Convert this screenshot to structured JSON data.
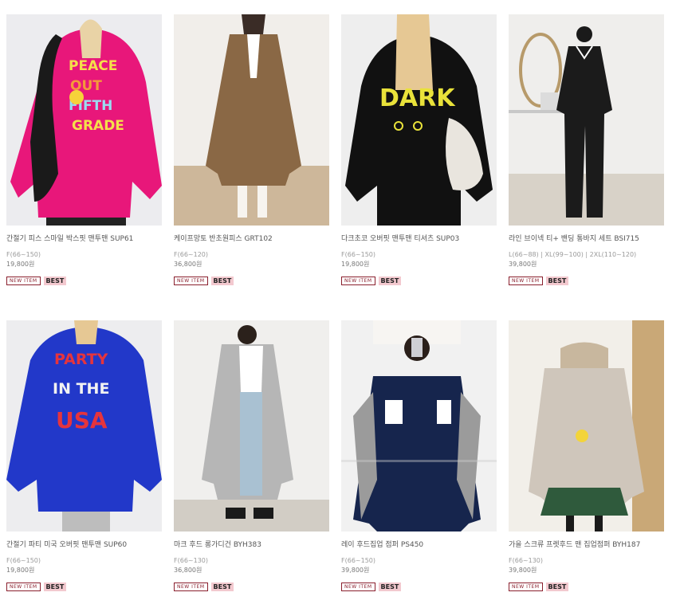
{
  "products": [
    {
      "name": "간절기 피스 스마일 박스핏 맨투맨 SUP61",
      "size": "F(66~150)",
      "price": "19,800원",
      "badge_new": "NEW ITEM",
      "badge_best": "BEST",
      "graphic_text": [
        "PEACE",
        "OUT",
        "FIFTH",
        "GRADE"
      ]
    },
    {
      "name": "케이프망토 반초원피스 GRT102",
      "size": "F(66~120)",
      "price": "36,800원",
      "badge_new": "NEW ITEM",
      "badge_best": "BEST"
    },
    {
      "name": "다크초코 오버핏 맨투맨 티셔츠 SUP03",
      "size": "F(66~150)",
      "price": "19,800원",
      "badge_new": "NEW ITEM",
      "badge_best": "BEST",
      "graphic_text": [
        "DARK"
      ]
    },
    {
      "name": "라인 브이넥 티+ 밴딩 통바지 세트 BSI715",
      "size": "L(66~88) | XL(99~100) | 2XL(110~120)",
      "price": "39,800원",
      "badge_new": "NEW ITEM",
      "badge_best": "BEST"
    },
    {
      "name": "간절기 파티 미국 오버핏 맨투맨 SUP60",
      "size": "F(66~150)",
      "price": "19,800원",
      "badge_new": "NEW ITEM",
      "badge_best": "BEST",
      "graphic_text": [
        "PARTY",
        "IN THE",
        "USA"
      ]
    },
    {
      "name": "마크 후드 롱가디건 BYH383",
      "size": "F(66~130)",
      "price": "36,800원",
      "badge_new": "NEW ITEM",
      "badge_best": "BEST"
    },
    {
      "name": "레이 후드집업 점퍼 PS450",
      "size": "F(66~150)",
      "price": "39,800원",
      "badge_new": "NEW ITEM",
      "badge_best": "BEST"
    },
    {
      "name": "가을 스크류 프렛후드 맨 집업점퍼 BYH187",
      "size": "F(66~130)",
      "price": "39,800원",
      "badge_new": "NEW ITEM",
      "badge_best": "BEST"
    }
  ],
  "colors": {
    "badge_new": "#8a1f2d",
    "badge_best_bg": "#f3c9cf",
    "name_text": "#555555",
    "meta_text": "#9a9a9a"
  }
}
